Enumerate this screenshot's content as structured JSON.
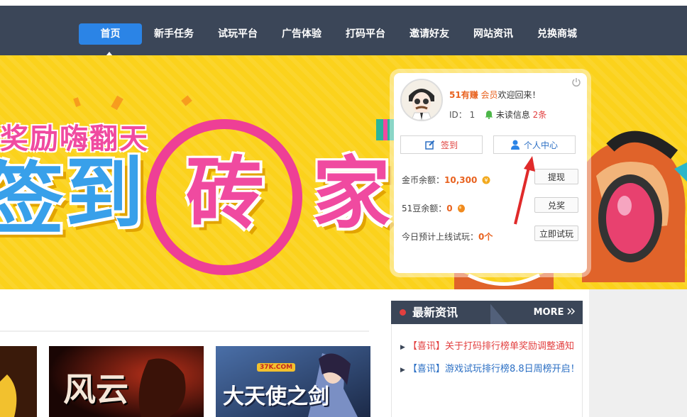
{
  "nav": {
    "items": [
      {
        "label": "首页",
        "active": true
      },
      {
        "label": "新手任务"
      },
      {
        "label": "试玩平台"
      },
      {
        "label": "广告体验"
      },
      {
        "label": "打码平台"
      },
      {
        "label": "邀请好友"
      },
      {
        "label": "网站资讯"
      },
      {
        "label": "兑换商城"
      }
    ]
  },
  "banner": {
    "subtitle": "奖励嗨翻天",
    "big_chars": [
      "签",
      "到",
      "砖",
      "家"
    ]
  },
  "panel": {
    "site_name": "51有赚",
    "member_label": "会员",
    "welcome_suffix": "欢迎回来！",
    "id_label": "ID：",
    "id_value": "1",
    "unread_label": "未读信息",
    "unread_count": "2条",
    "sign_label": "签到",
    "center_label": "个人中心",
    "coin_label": "金币余额：",
    "coin_value": "10,300",
    "withdraw_label": "提现",
    "bean_label": "51豆余额：",
    "bean_value": "0",
    "prize_label": "兑奖",
    "today_label": "今日预计上线试玩：",
    "today_value": "0个",
    "try_label": "立即试玩"
  },
  "news": {
    "title": "最新资讯",
    "more": "MORE",
    "items": [
      {
        "tag": "【喜讯】",
        "text": "关于打码排行榜单奖励调整通知",
        "color": "#e23f3f"
      },
      {
        "tag": "【喜讯】",
        "text": "游戏试玩排行榜8.8日周榜开启！",
        "color": "#2b6fc4"
      }
    ]
  },
  "games": [
    {
      "name": "game-banner-1"
    },
    {
      "name": "game-banner-2",
      "text": "风云"
    },
    {
      "name": "game-banner-3",
      "logo": "37K.COM",
      "text": "大天使之剑"
    }
  ],
  "colors": {
    "nav_bg": "#3b4658",
    "nav_active": "#2b84e6",
    "banner_bg": "#fbd21c",
    "accent_orange": "#e8621f",
    "accent_red": "#e23f3f",
    "link_blue": "#2b6fc4"
  }
}
